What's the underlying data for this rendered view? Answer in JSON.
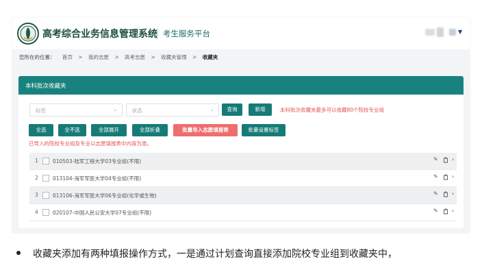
{
  "header": {
    "system_title": "高考综合业务信息管理系统",
    "subtitle": "考生服务平台"
  },
  "breadcrumb": {
    "label": "您所在的位置：",
    "items": [
      "首页",
      ">",
      "我的志愿",
      ">",
      "高考志愿",
      ">",
      "收藏夹管理",
      ">",
      "收藏夹"
    ]
  },
  "panel": {
    "title": "本科批次收藏夹",
    "filters": {
      "tag_placeholder": "标签",
      "status_placeholder": "状态"
    },
    "buttons": {
      "query": "查询",
      "add": "新增",
      "select_all": "全选",
      "deselect_all": "全不选",
      "expand_all": "全部展开",
      "collapse_all": "全部折叠",
      "batch_import": "批量导入志愿填报表",
      "batch_tag": "批量设置标签"
    },
    "limit_hint": "本科批次收藏夹最多可以收藏80个院校专业组",
    "import_note": "已导入的院校专业组及专业以志愿填报表中内容为准。",
    "rows": [
      {
        "index": "1",
        "text": "010503-陆军工程大学03专业组(不限)"
      },
      {
        "index": "2",
        "text": "013104-海军军医大学04专业组(不限)"
      },
      {
        "index": "3",
        "text": "013106-海军军医大学06专业组(化学或生物)"
      },
      {
        "index": "4",
        "text": "020107-中国人民公安大学07专业组(不限)"
      }
    ],
    "row_icons": [
      "pencil-icon",
      "trash-icon",
      "chevron-right-icon"
    ]
  },
  "caption": "收藏夹添加有两种填报操作方式，一是通过计划查询直接添加院校专业组到收藏夹中，",
  "colors": {
    "accent": "#19827e",
    "button": "#167b77",
    "danger": "#ee6e6e",
    "hint": "#e55353",
    "title": "#1a4f3a"
  }
}
